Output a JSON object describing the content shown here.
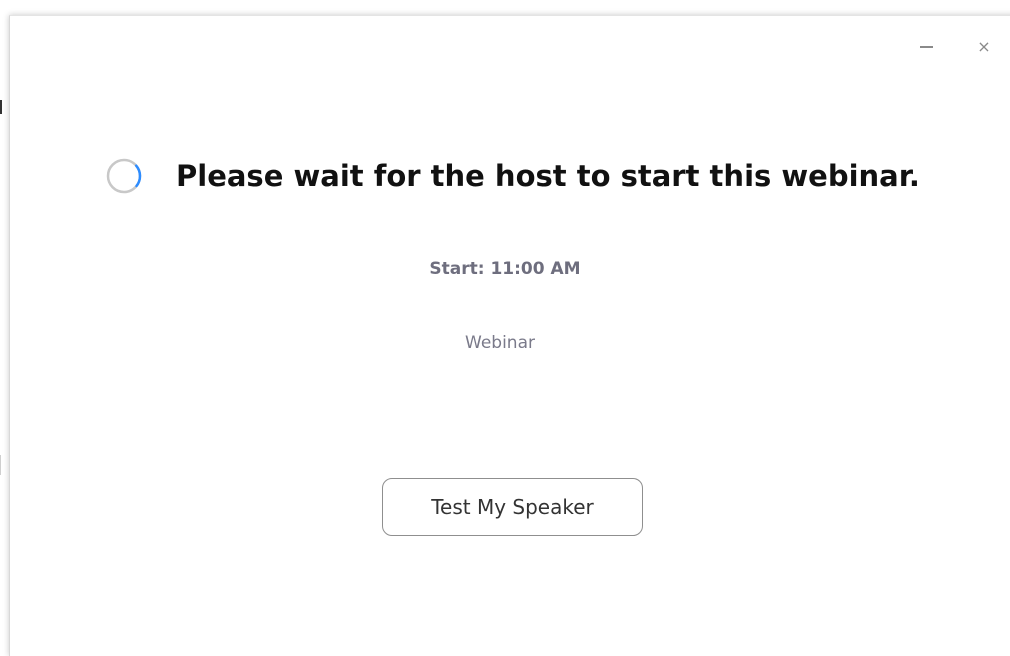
{
  "window": {
    "minimize_icon": "minimize-icon",
    "close_icon": "close-icon",
    "close_glyph": "×"
  },
  "main": {
    "heading": "Please wait for the host to start this webinar.",
    "start_time": "Start: 11:00 AM",
    "webinar_label": "Webinar",
    "test_speaker_label": "Test My Speaker",
    "spinner_icon": "loading-spinner-icon"
  },
  "colors": {
    "spinner_track": "#c8c8c8",
    "spinner_accent": "#2d8cff",
    "heading": "#111111",
    "subtext": "#6e6e7e"
  }
}
